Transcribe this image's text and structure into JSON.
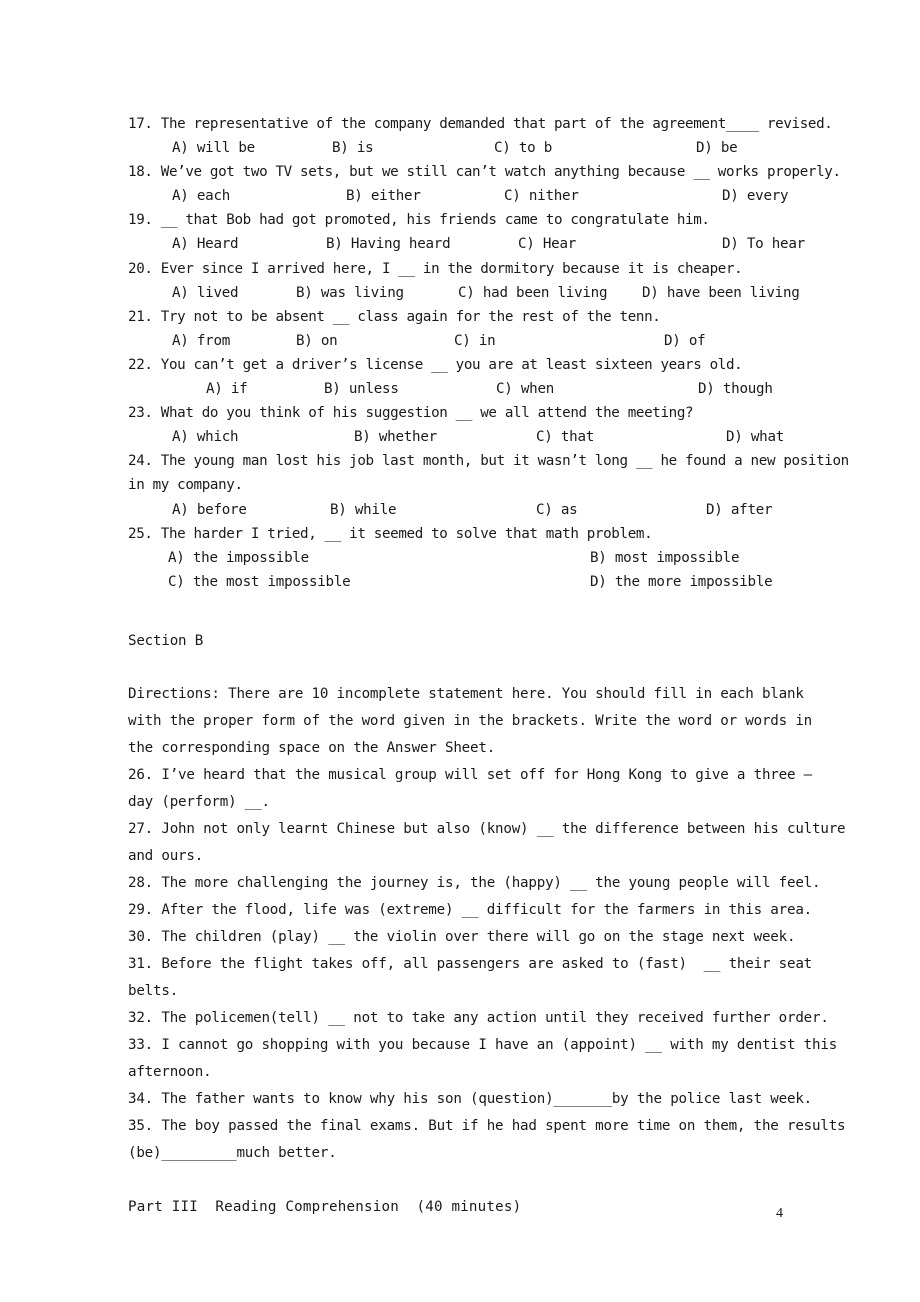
{
  "document": {
    "page_number": "4",
    "sectionA_questions": [
      {
        "number": "17.",
        "text": "17. The representative of the company demanded that part of the agreement____ revised.",
        "options": {
          "a": "A) will be",
          "b": "B) is",
          "c": "C) to b",
          "d": "D) be"
        }
      },
      {
        "number": "18.",
        "text": "18. We’ve got two TV sets, but we still can’t watch anything because __ works properly.",
        "options": {
          "a": "A) each",
          "b": "B) either",
          "c": "C) nither",
          "d": "D) every"
        }
      },
      {
        "number": "19.",
        "text": "19. __ that Bob had got promoted, his friends came to congratulate him.",
        "options": {
          "a": "A) Heard",
          "b": "B) Having heard",
          "c": "C) Hear",
          "d": "D) To hear"
        }
      },
      {
        "number": "20.",
        "text": "20. Ever since I arrived here, I __ in the dormitory because it is cheaper.",
        "options": {
          "a": "A) lived",
          "b": "B) was living",
          "c": "C) had been living",
          "d": "D) have been living"
        }
      },
      {
        "number": "21.",
        "text": "21. Try not to be absent __ class again for the rest of the tenn.",
        "options": {
          "a": "A) from",
          "b": "B) on",
          "c": "C) in",
          "d": "D) of"
        }
      },
      {
        "number": "22.",
        "text": "22. You can’t get a driver’s license __ you are at least sixteen years old.",
        "options": {
          "a": "A) if",
          "b": "B) unless",
          "c": "C) when",
          "d": "D) though"
        }
      },
      {
        "number": "23.",
        "text": "23. What do you think of his suggestion __ we all attend the meeting?",
        "options": {
          "a": "A) which",
          "b": "B) whether",
          "c": "C) that",
          "d": "D) what"
        }
      },
      {
        "number": "24.",
        "text": "24. The young man lost his job last month, but it wasn’t long __ he found a new position",
        "text_cont": "in my company.",
        "options": {
          "a": "A) before",
          "b": "B) while",
          "c": "C) as",
          "d": "D) after"
        }
      },
      {
        "number": "25.",
        "text": "25. The harder I tried, __ it seemed to solve that math problem.",
        "options_two_column": {
          "a": "A) the impossible",
          "b": "B) most impossible",
          "c": "C) the most impossible",
          "d": "D) the more impossible"
        }
      }
    ],
    "sectionB": {
      "heading": "Section B",
      "directions_lines": [
        "Directions: There are 10 incomplete statement here. You should fill in each blank",
        "with the proper form of the word given in the brackets. Write the word or words in",
        "the corresponding space on the Answer Sheet."
      ],
      "questions": [
        {
          "number": "26.",
          "lines": [
            "26. I’ve heard that the musical group will set off for Hong Kong to give a three –",
            "day (perform) __."
          ]
        },
        {
          "number": "27.",
          "lines": [
            "27. John not only learnt Chinese but also (know) __ the difference between his culture",
            "and ours."
          ]
        },
        {
          "number": "28.",
          "lines": [
            "28. The more challenging the journey is, the (happy) __ the young people will feel."
          ]
        },
        {
          "number": "29.",
          "lines": [
            "29. After the flood, life was (extreme) __ difficult for the farmers in this area."
          ]
        },
        {
          "number": "30.",
          "lines": [
            "30. The children (play) __ the violin over there will go on the stage next week."
          ]
        },
        {
          "number": "31.",
          "lines": [
            "31. Before the flight takes off, all passengers are asked to (fast)  __ their seat",
            "belts."
          ]
        },
        {
          "number": "32.",
          "lines": [
            "32. The policemen(tell) __ not to take any action until they received further order."
          ]
        },
        {
          "number": "33.",
          "lines": [
            "33. I cannot go shopping with you because I have an (appoint) __ with my dentist this",
            "afternoon."
          ]
        },
        {
          "number": "34.",
          "lines": [
            "34. The father wants to know why his son (question)_______by the police last week."
          ]
        },
        {
          "number": "35.",
          "lines": [
            "35. The boy passed the final exams. But if he had spent more time on them, the results",
            "(be)_________much better."
          ]
        }
      ]
    },
    "partIII": {
      "heading": "Part III  Reading Comprehension  (40 minutes)"
    }
  }
}
